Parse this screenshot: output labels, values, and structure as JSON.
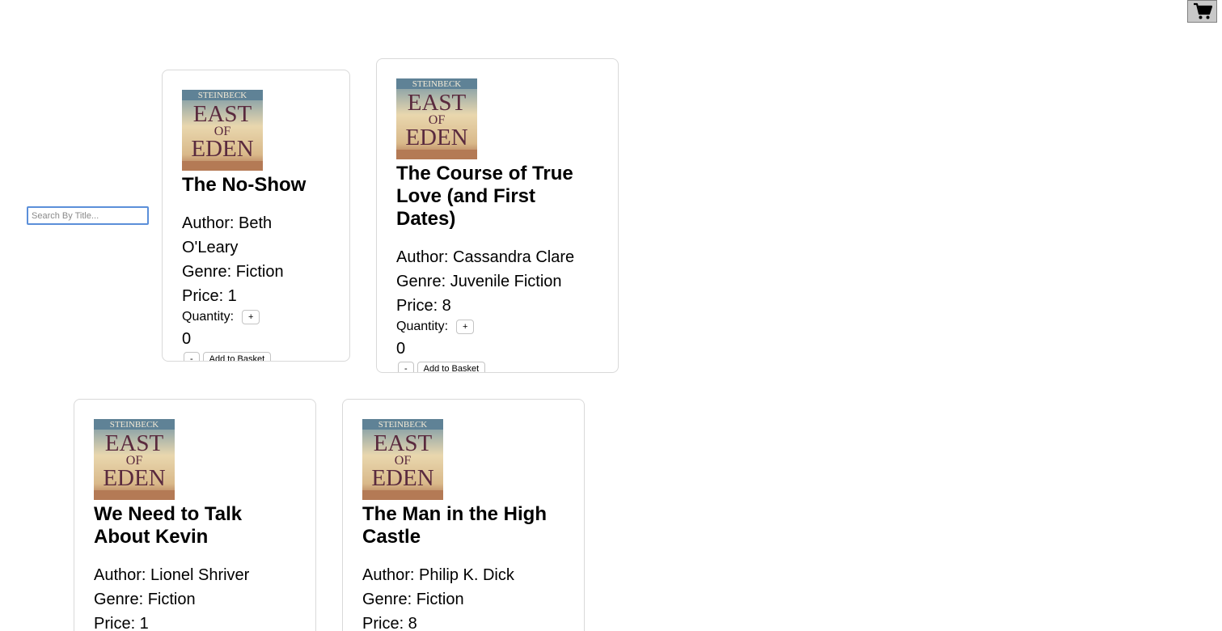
{
  "header": {
    "cart_icon": "shopping-cart-icon"
  },
  "search": {
    "placeholder": "Search By Title..."
  },
  "cover": {
    "author_text": "STEINBECK",
    "title_line1": "EAST",
    "title_line2": "OF",
    "title_line3": "EDEN"
  },
  "books": [
    {
      "title": "The No-Show",
      "author": "Author: Beth O'Leary",
      "genre": "Genre: Fiction",
      "price": "Price: 1",
      "quantity_label": "Quantity:",
      "quantity": "0",
      "plus_label": "+",
      "minus_label": "-",
      "add_label": "Add to Basket"
    },
    {
      "title": "The Course of True Love (and First Dates)",
      "author": "Author: Cassandra Clare",
      "genre": "Genre: Juvenile Fiction",
      "price": "Price: 8",
      "quantity_label": "Quantity:",
      "quantity": "0",
      "plus_label": "+",
      "minus_label": "-",
      "add_label": "Add to Basket"
    },
    {
      "title": "We Need to Talk About Kevin",
      "author": "Author: Lionel Shriver",
      "genre": "Genre: Fiction",
      "price": "Price: 1"
    },
    {
      "title": "The Man in the High Castle",
      "author": "Author: Philip K. Dick",
      "genre": "Genre: Fiction",
      "price": "Price: 8"
    }
  ],
  "colors": {
    "search_border": "#5b8fd9",
    "card_border": "#d9d9d9",
    "cart_bg": "#c8c8c8"
  }
}
